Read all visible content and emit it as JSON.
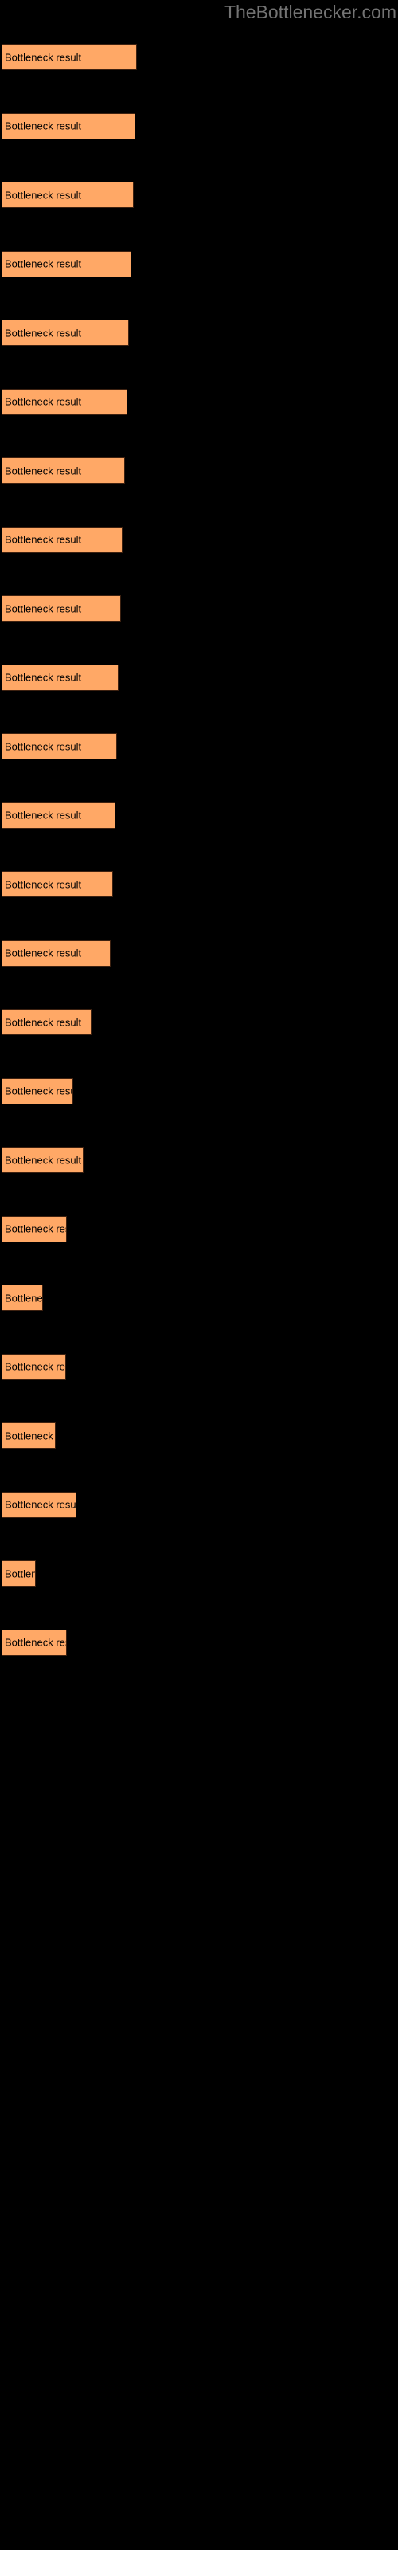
{
  "watermark": {
    "text": "TheBottleneckerLcom",
    "display": "TheBottlenecker.com",
    "color": "#737373"
  },
  "chart_data": {
    "type": "bar",
    "orientation": "horizontal",
    "title": "",
    "subtitle": "",
    "xlabel": "",
    "ylabel": "",
    "background": "#000000",
    "bar_color": "#ffa866",
    "bar_border_color": "#3d2110",
    "label_color": "#000000",
    "grid": false,
    "legend": null,
    "axis_visible": false,
    "tick_labels": [],
    "bar_label_text": "Bottleneck result",
    "categories": [
      "Bottleneck result",
      "Bottleneck result",
      "Bottleneck result",
      "Bottleneck result",
      "Bottleneck result",
      "Bottleneck result",
      "Bottleneck result",
      "Bottleneck result",
      "Bottleneck result",
      "Bottleneck result",
      "Bottleneck result",
      "Bottleneck result",
      "Bottleneck result",
      "Bottleneck result",
      "Bottleneck result",
      "Bottleneck result",
      "Bottleneck result",
      "Bottleneck result",
      "Bottleneck result",
      "Bottleneck result",
      "Bottleneck result",
      "Bottleneck result",
      "Bottleneck result",
      "Bottleneck result"
    ],
    "values": [
      170,
      168,
      166,
      163,
      160,
      158,
      155,
      152,
      150,
      147,
      145,
      143,
      140,
      137,
      113,
      90,
      103,
      82,
      52,
      81,
      68,
      94,
      43,
      82
    ],
    "xlim": [
      0,
      498
    ],
    "bars": [
      {
        "index": 1,
        "top": 55,
        "width": 170,
        "visible_text": "Bottleneck result"
      },
      {
        "index": 2,
        "top": 141.5,
        "width": 168,
        "visible_text": "Bottleneck result"
      },
      {
        "index": 3,
        "top": 228,
        "width": 166,
        "visible_text": "Bottleneck result"
      },
      {
        "index": 4,
        "top": 314.5,
        "width": 163,
        "visible_text": "Bottleneck result"
      },
      {
        "index": 5,
        "top": 401,
        "width": 160,
        "visible_text": "Bottleneck result"
      },
      {
        "index": 6,
        "top": 487.5,
        "width": 158,
        "visible_text": "Bottleneck result"
      },
      {
        "index": 7,
        "top": 574,
        "width": 155,
        "visible_text": "Bottleneck result"
      },
      {
        "index": 8,
        "top": 660.5,
        "width": 152,
        "visible_text": "Bottleneck result"
      },
      {
        "index": 9,
        "top": 747,
        "width": 150,
        "visible_text": "Bottleneck result"
      },
      {
        "index": 10,
        "top": 833.5,
        "width": 147,
        "visible_text": "Bottleneck result"
      },
      {
        "index": 11,
        "top": 920,
        "width": 145,
        "visible_text": "Bottleneck result"
      },
      {
        "index": 12,
        "top": 1006.5,
        "width": 143,
        "visible_text": "Bottleneck result"
      },
      {
        "index": 13,
        "top": 1093,
        "width": 140,
        "visible_text": "Bottleneck result"
      },
      {
        "index": 14,
        "top": 1179.5,
        "width": 137,
        "visible_text": "Bottleneck result"
      },
      {
        "index": 15,
        "top": 1266,
        "width": 113,
        "visible_text": "Bottleneck re"
      },
      {
        "index": 16,
        "top": 1352.5,
        "width": 90,
        "visible_text": "Bottlene"
      },
      {
        "index": 17,
        "top": 1439,
        "width": 103,
        "visible_text": "Bottleneck r"
      },
      {
        "index": 18,
        "top": 1525.5,
        "width": 82,
        "visible_text": "Bottlen"
      },
      {
        "index": 19,
        "top": 1612,
        "width": 52,
        "visible_text": "Bot"
      },
      {
        "index": 20,
        "top": 1698.5,
        "width": 81,
        "visible_text": "Bottlen"
      },
      {
        "index": 21,
        "top": 1785,
        "width": 68,
        "visible_text": "Bottle"
      },
      {
        "index": 22,
        "top": 1871.5,
        "width": 94,
        "visible_text": "Bottlenec"
      },
      {
        "index": 23,
        "top": 1958,
        "width": 43,
        "visible_text": "Bo"
      },
      {
        "index": 24,
        "top": 2044.5,
        "width": 82,
        "visible_text": "Bottler"
      }
    ]
  }
}
